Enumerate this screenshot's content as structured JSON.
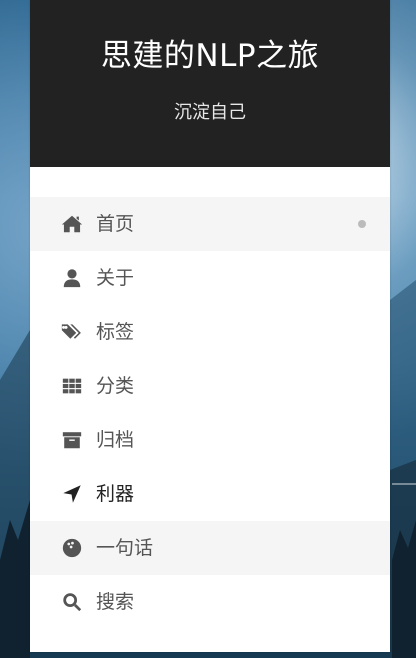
{
  "brand": {
    "title": "思建的NLP之旅",
    "subtitle": "沉淀自己"
  },
  "menu": {
    "items": [
      {
        "label": "首页",
        "icon": "home-icon",
        "active": true
      },
      {
        "label": "关于",
        "icon": "user-icon"
      },
      {
        "label": "标签",
        "icon": "tags-icon"
      },
      {
        "label": "分类",
        "icon": "th-grid-icon"
      },
      {
        "label": "归档",
        "icon": "archive-icon"
      },
      {
        "label": "利器",
        "icon": "location-arrow-icon"
      },
      {
        "label": "一句话",
        "icon": "bowling-ball-icon"
      },
      {
        "label": "搜索",
        "icon": "search-icon"
      }
    ]
  },
  "colors": {
    "header_bg": "#222222",
    "menu_text": "#555555",
    "active_bg": "#f5f5f5"
  }
}
